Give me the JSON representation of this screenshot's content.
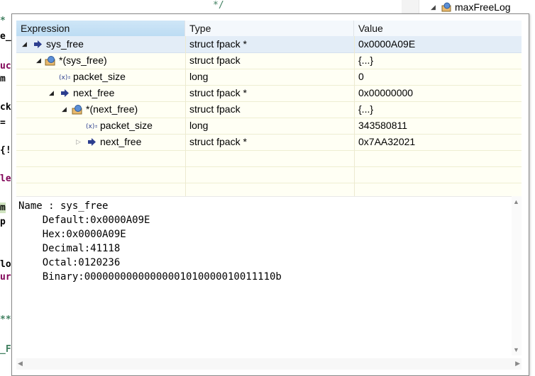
{
  "outline": {
    "label": "maxFreeLog"
  },
  "background_code": {
    "comment_fragment": "*/",
    "left_fragments": [
      "*",
      "e_",
      "uct",
      "m",
      "ck",
      "=",
      "{!",
      "le",
      "m",
      "p",
      "lo",
      "ur",
      "**",
      "_F"
    ]
  },
  "columns": {
    "expression": "Expression",
    "type": "Type",
    "value": "Value"
  },
  "rows": [
    {
      "name": "sys_free",
      "type": "struct fpack *",
      "value": "0x0000A09E"
    },
    {
      "name": "*(sys_free)",
      "type": "struct fpack",
      "value": "{...}"
    },
    {
      "name": "packet_size",
      "type": "long",
      "value": "0"
    },
    {
      "name": "next_free",
      "type": "struct fpack *",
      "value": "0x00000000"
    },
    {
      "name": "*(next_free)",
      "type": "struct fpack",
      "value": "{...}"
    },
    {
      "name": "packet_size",
      "type": "long",
      "value": "343580811"
    },
    {
      "name": "next_free",
      "type": "struct fpack *",
      "value": "0x7AA32021"
    }
  ],
  "details": {
    "name_line": "Name : sys_free",
    "default_line": "    Default:0x0000A09E",
    "hex_line": "    Hex:0x0000A09E",
    "decimal_line": "    Decimal:41118",
    "octal_line": "    Octal:0120236",
    "binary_line": "    Binary:00000000000000001010000010011110b"
  },
  "colors": {
    "tree_bg": "#fffff4",
    "selected_row": "#e3edf7",
    "header_selected": "#bcdcf3"
  }
}
